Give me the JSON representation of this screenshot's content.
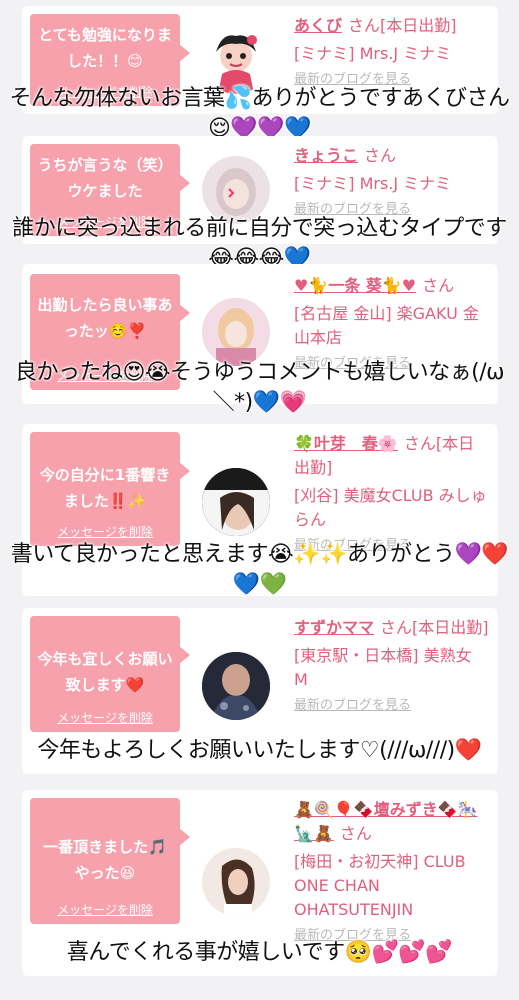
{
  "messages": [
    {
      "bubble": "とても勉強になりました！！😊",
      "delete_label": "メッセージを削除",
      "name": "あくび",
      "suffix": "さん[本日出勤]",
      "shop": "[ミナミ] Mrs.J ミナミ",
      "blog": "最新のブログを見る",
      "reply": "そんな勿体ないお言葉💦ありがとうですあくびさん😌💜💜💙"
    },
    {
      "bubble": "うちが言うな（笑）ウケました",
      "delete_label": "メッセージを削除",
      "name": "きょうこ",
      "suffix": "さん",
      "shop": "[ミナミ] Mrs.J ミナミ",
      "blog": "最新のブログを見る",
      "reply": "誰かに突っ込まれる前に自分で突っ込むタイプです😂😂😂💙"
    },
    {
      "bubble": "出勤したら良い事あったッ☺️❣️",
      "delete_label": "メッセージを削除",
      "name": "♥🐈一条 葵🐈♥",
      "suffix": "さん",
      "shop": "[名古屋 金山] 楽GAKU 金山本店",
      "blog": "最新のブログを見る",
      "reply": "良かったね😍😭そうゆうコメントも嬉しいなぁ(/ω＼*)💙💗"
    },
    {
      "bubble": "今の自分に1番響きました‼️✨",
      "delete_label": "メッセージを削除",
      "name": "🍀叶芽　春🌸",
      "suffix": "さん[本日出勤]",
      "shop": "[刈谷] 美魔女CLUB みしゅらん",
      "blog": "最新のブログを見る",
      "reply": "書いて良かったと思えます😭✨✨ありがとう💜❤️💙💚"
    },
    {
      "bubble": "今年も宜しくお願い致します❤️",
      "delete_label": "メッセージを削除",
      "name": "すずかママ",
      "suffix": "さん[本日出勤]",
      "shop": "[東京駅・日本橋] 美熟女 M",
      "blog": "最新のブログを見る",
      "reply": "今年もよろしくお願いいたします♡(///ω///)❤️"
    },
    {
      "bubble": "一番頂きました🎵やった😆",
      "delete_label": "メッセージを削除",
      "name": "🧸🍭🎈🍫壇みずき🍫🎠🗽🧸",
      "suffix": "さん",
      "shop": "[梅田・お初天神] CLUB ONE CHAN OHATSUTENJIN",
      "blog": "最新のブログを見る",
      "reply": "喜んでくれる事が嬉しいです🥺💕💕💕"
    }
  ],
  "colors": {
    "bubble": "#f7a1ad",
    "name": "#e0607e",
    "background": "#f2f2f4"
  }
}
